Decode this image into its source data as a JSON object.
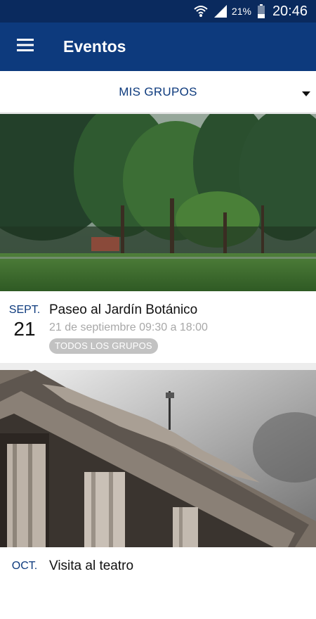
{
  "status_bar": {
    "battery_percent": "21%",
    "time": "20:46",
    "icons": [
      "wifi-icon",
      "signal-icon",
      "battery-icon"
    ]
  },
  "app_bar": {
    "title": "Eventos",
    "menu_icon": "hamburger-menu-icon"
  },
  "group_selector": {
    "selected": "MIS GRUPOS",
    "icon": "dropdown-arrow-icon"
  },
  "events": [
    {
      "month": "SEPT.",
      "day": "21",
      "title": "Paseo al Jardín Botánico",
      "time": "21 de septiembre 09:30 a 18:00",
      "tag": "TODOS LOS GRUPOS",
      "image": "park-trees-photo"
    },
    {
      "month": "OCT.",
      "day": "",
      "title": "Visita al teatro",
      "time": "",
      "tag": "",
      "image": "theatre-columns-photo"
    }
  ],
  "colors": {
    "primary": "#0d3a7d",
    "status_bar": "#0a2a5e",
    "tag_background": "#c2c2c2",
    "muted_text": "#a8a8a8"
  }
}
